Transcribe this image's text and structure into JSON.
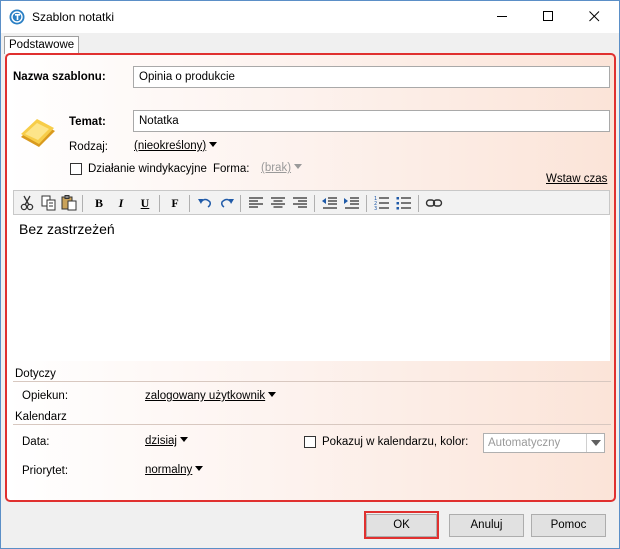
{
  "window": {
    "title": "Szablon notatki"
  },
  "tabs": [
    {
      "label": "Podstawowe"
    }
  ],
  "form": {
    "template_name_label": "Nazwa szablonu:",
    "template_name_value": "Opinia o produkcie",
    "subject_label": "Temat:",
    "subject_value": "Notatka",
    "type_label": "Rodzaj:",
    "type_value": "(nieokreślony)",
    "recovery_label": "Działanie windykacyjne",
    "recovery_checked": false,
    "form_label": "Forma:",
    "form_value": "(brak)",
    "insert_time_link": "Wstaw czas"
  },
  "toolbar": {
    "icons": [
      "scissors-icon",
      "copy-icon",
      "paste-icon",
      "bold-icon",
      "italic-icon",
      "underline-icon",
      "font-icon",
      "undo-icon",
      "redo-icon",
      "align-left-icon",
      "align-center-icon",
      "align-right-icon",
      "outdent-icon",
      "indent-icon",
      "numbered-list-icon",
      "bullet-list-icon",
      "link-icon"
    ],
    "bold": "B",
    "italic": "I",
    "underline": "U",
    "font": "F"
  },
  "editor": {
    "text": "Bez zastrzeżeń"
  },
  "concerns": {
    "section_label": "Dotyczy",
    "guardian_label": "Opiekun:",
    "guardian_value": "zalogowany użytkownik"
  },
  "calendar": {
    "section_label": "Kalendarz",
    "date_label": "Data:",
    "date_value": "dzisiaj",
    "show_label": "Pokazuj w kalendarzu, kolor:",
    "show_checked": false,
    "color_value": "Automatyczny",
    "priority_label": "Priorytet:",
    "priority_value": "normalny"
  },
  "buttons": {
    "ok": "OK",
    "cancel": "Anuluj",
    "help": "Pomoc"
  },
  "colors": {
    "highlight": "#e0302f",
    "accent": "#5b8fc7"
  }
}
